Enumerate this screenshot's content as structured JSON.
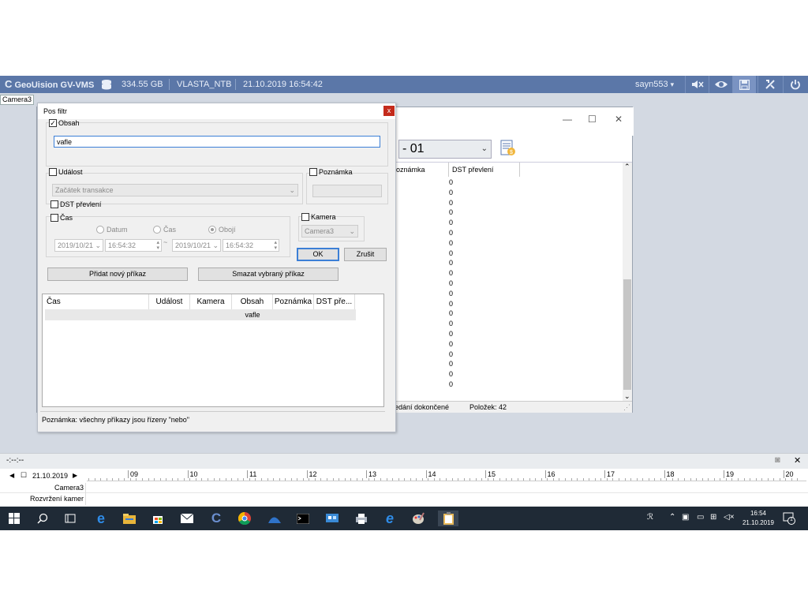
{
  "topbar": {
    "brand": "GeoUision GV-VMS",
    "storage": "334.55 GB",
    "host": "VLASTA_NTB",
    "datetime": "21.10.2019 16:54:42",
    "user": "sayn553",
    "user_arrow": "▾"
  },
  "camera_tab": "Camera3",
  "back_window": {
    "select_value": "- 01",
    "columns": [
      "poznámka",
      "DST převlení"
    ],
    "values": [
      "0",
      "0",
      "0",
      "0",
      "0",
      "0",
      "0",
      "0",
      "0",
      "0",
      "0",
      "0",
      "0",
      "0",
      "0",
      "0",
      "0",
      "0",
      "0",
      "0",
      "0"
    ],
    "status_left": "hledání dokončené",
    "status_right": "Položek: 42"
  },
  "dialog": {
    "title": "Pos filtr",
    "close": "x",
    "obsah_label": "Obsah",
    "obsah_checked": true,
    "obsah_value": "vafle",
    "udalost_label": "Událost",
    "udalost_value": "Začátek transakce",
    "poznamka_label": "Poznámka",
    "dst_label": "DST převlení",
    "cas_label": "Čas",
    "radio_datum": "Datum",
    "radio_cas": "Čas",
    "radio_oboji": "Obojí",
    "date_from": "2019/10/21",
    "time_from": "16:54:32",
    "date_to": "2019/10/21",
    "time_to": "16:54:32",
    "range_sep": "~",
    "kamera_label": "Kamera",
    "kamera_value": "Camera3",
    "ok_label": "OK",
    "cancel_label": "Zrušit",
    "add_label": "Přidat nový příkaz",
    "delete_label": "Smazat vybraný příkaz",
    "table_headers": [
      "Čas",
      "Událost",
      "Kamera",
      "Obsah",
      "Poznámka",
      "DST pře..."
    ],
    "table_row_obsah": "vafle",
    "note": "Poznámka: všechny příkazy jsou řízeny \"nebo\""
  },
  "scale_label": "-:--:--",
  "timeline": {
    "date": "21.10.2019",
    "hours": [
      "09",
      "10",
      "11",
      "12",
      "13",
      "14",
      "15",
      "16",
      "17",
      "18",
      "19",
      "20"
    ],
    "row1": "Camera3",
    "row2": "Rozvržení kamer"
  },
  "taskbar": {
    "time": "16:54",
    "date": "21.10.2019",
    "notif_count": "1"
  },
  "colors": {
    "topbar": "#5b77a8",
    "taskbar": "#1f2a36",
    "close_red": "#c42b1c",
    "default_button_border": "#3c7fd6"
  }
}
